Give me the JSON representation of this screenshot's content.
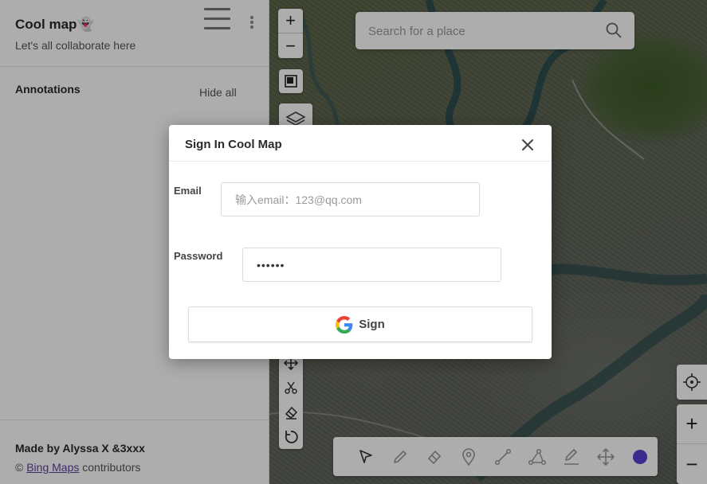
{
  "sidebar": {
    "title": "Cool map",
    "title_emoji": "👻",
    "subtitle": "Let's all collaborate here",
    "annotations_heading": "Annotations",
    "hide_all_label": "Hide all",
    "footer_made_by": "Made by Alyssa X &3xxx",
    "footer_copyright": "©",
    "footer_link": "Bing Maps",
    "footer_suffix": "contributors"
  },
  "map": {
    "zoom_in_label": "+",
    "zoom_out_label": "−",
    "search_placeholder": "Search for a place",
    "bottom_tools": [
      "select-icon",
      "pencil-icon",
      "eraser-icon",
      "marker-icon",
      "line-icon",
      "polygon-icon",
      "draw-icon",
      "move-icon",
      "color-icon"
    ],
    "active_color": "#5b3fd1",
    "right_zoom_in_label": "+",
    "right_zoom_out_label": "−"
  },
  "modal": {
    "title": "Sign In Cool Map",
    "email_label": "Email",
    "email_placeholder": "输入email：123@qq.com",
    "password_label": "Password",
    "password_value": "••••••",
    "sign_button_label": "Sign"
  }
}
